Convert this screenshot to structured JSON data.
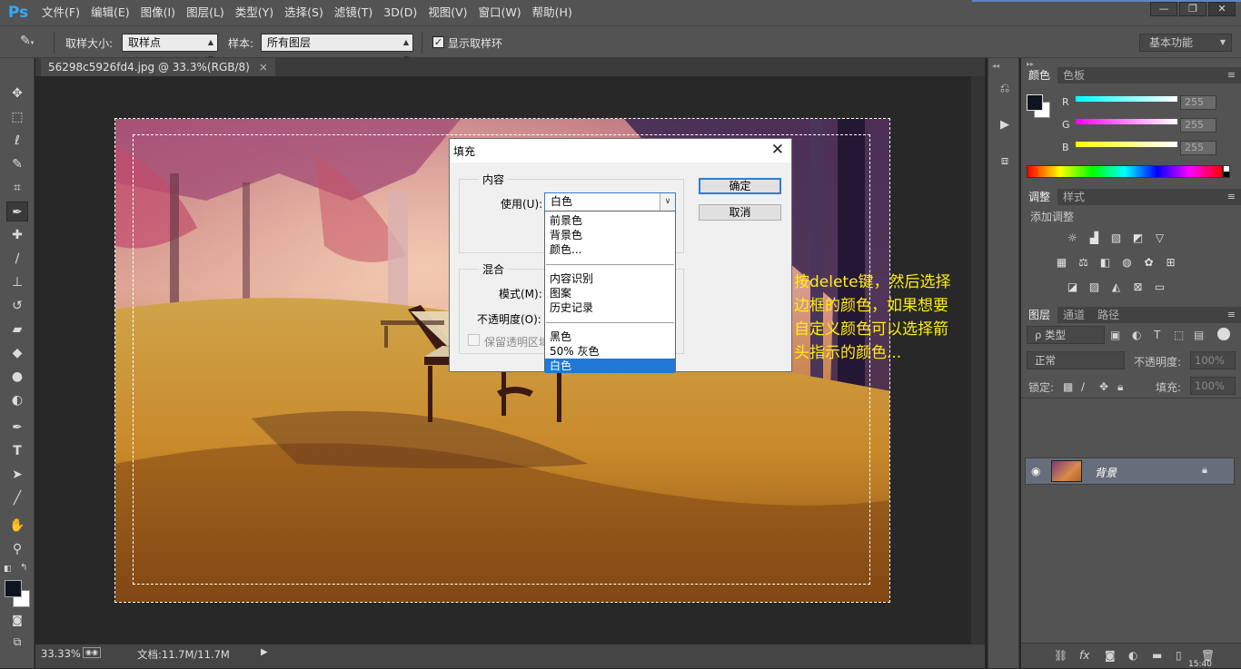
{
  "app": {
    "logo": "Ps",
    "menu": [
      "文件(F)",
      "编辑(E)",
      "图像(I)",
      "图层(L)",
      "类型(Y)",
      "选择(S)",
      "滤镜(T)",
      "3D(D)",
      "视图(V)",
      "窗口(W)",
      "帮助(H)"
    ],
    "window_controls": {
      "minimize": "—",
      "restore": "❐",
      "close": "✕"
    }
  },
  "options_bar": {
    "sample_size_label": "取样大小:",
    "sample_size_value": "取样点",
    "sample_label": "样本:",
    "sample_value": "所有图层",
    "show_ring_label": "显示取样环",
    "show_ring_checked": true,
    "workspace": "基本功能"
  },
  "document": {
    "tab_title": "56298c5926fd4.jpg @ 33.3%(RGB/8)",
    "tab_close": "×"
  },
  "status_bar": {
    "zoom": "33.33%",
    "doc_info": "文档:11.7M/11.7M"
  },
  "fill_dialog": {
    "title": "填充",
    "close": "✕",
    "content_group": "内容",
    "use_label": "使用(U):",
    "use_value": "白色",
    "blend_group": "混合",
    "mode_label": "模式(M):",
    "opacity_label": "不透明度(O):",
    "preserve_label": "保留透明区域",
    "ok": "确定",
    "cancel": "取消"
  },
  "use_dropdown": {
    "items": [
      "前景色",
      "背景色",
      "颜色...",
      "内容识别",
      "图案",
      "历史记录",
      "黑色",
      "50% 灰色",
      "白色"
    ],
    "selected": "白色"
  },
  "annotation": {
    "lines": [
      "按delete键，然后选择",
      "边框的颜色，如果想要",
      "自定义颜色可以选择箭",
      "头指示的颜色..."
    ],
    "color": "#ffee10",
    "arrow_color": "#ea3434"
  },
  "color_panel": {
    "tabs": [
      "颜色",
      "色板"
    ],
    "channels": [
      {
        "label": "R",
        "value": "255"
      },
      {
        "label": "G",
        "value": "255"
      },
      {
        "label": "B",
        "value": "255"
      }
    ]
  },
  "adjustments_panel": {
    "tabs": [
      "调整",
      "样式"
    ],
    "heading": "添加调整"
  },
  "layers_panel": {
    "tabs": [
      "图层",
      "通道",
      "路径"
    ],
    "filter_kind": "ρ 类型",
    "blend_mode": "正常",
    "opacity_label": "不透明度:",
    "opacity_value": "100%",
    "lock_label": "锁定:",
    "fill_label": "填充:",
    "fill_value": "100%",
    "layers": [
      {
        "name": "背景",
        "visible": true,
        "locked": true
      }
    ]
  },
  "taskbar_clock": "15:40"
}
